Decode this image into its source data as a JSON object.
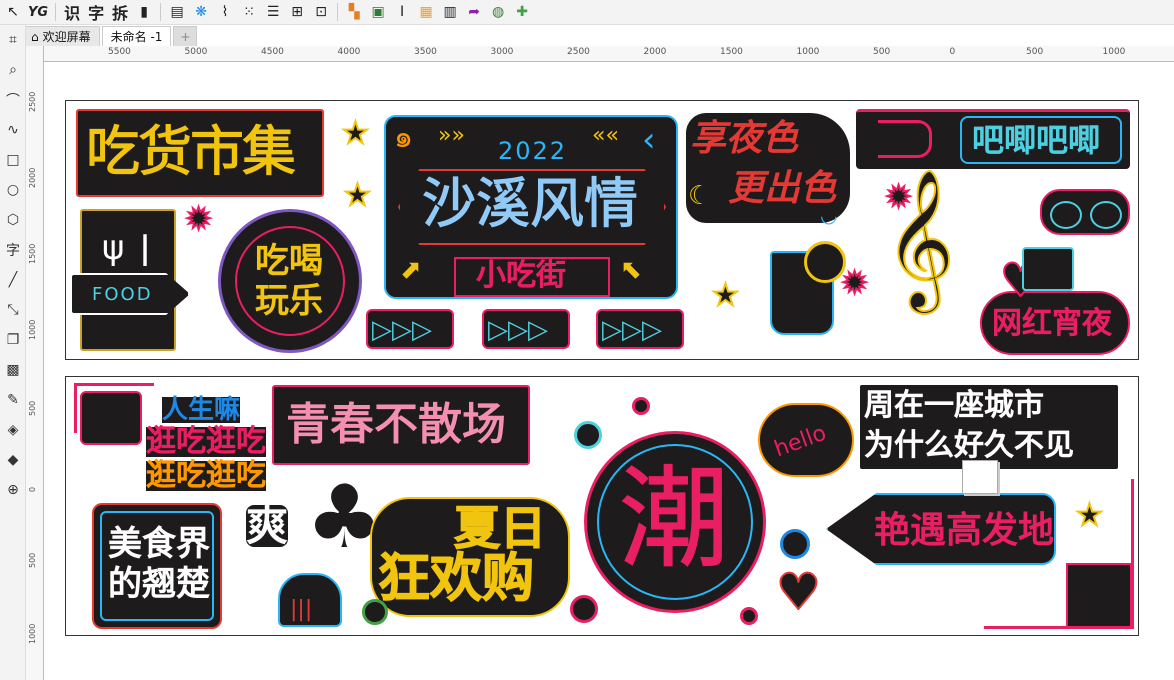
{
  "toolbar": {
    "yg": "YG",
    "shi": "识",
    "zi": "字",
    "chai": "拆"
  },
  "tabs": {
    "welcome": "欢迎屏幕",
    "doc": "未命名 -1",
    "add": "+"
  },
  "ruler": {
    "h": [
      "5500",
      "5000",
      "4500",
      "4000",
      "3500",
      "3000",
      "2500",
      "2000",
      "1500",
      "1000",
      "500",
      "0",
      "500",
      "1000"
    ],
    "v": [
      "2500",
      "2000",
      "1500",
      "1000",
      "500",
      "0",
      "500",
      "1000"
    ]
  },
  "signs": {
    "chihuo": "吃货市集",
    "year": "2022",
    "shaxi": "沙溪风情",
    "xiaochi": "小吃街",
    "xiangyese1": "享夜色",
    "xiangyese2": "更出色",
    "bala": "吧唧吧唧",
    "food": "FOOD",
    "chihe1": "吃喝",
    "chihe2": "玩乐",
    "wanghong": "网红宵夜",
    "rensheng": "人生嘛",
    "guang1": "逛吃逛吃",
    "guang2": "逛吃逛吃",
    "qingchun": "青春不散场",
    "hello": "hello",
    "city1": "周在一座城市",
    "city2": "为什么好久不见",
    "meishi1": "美食界",
    "meishi2": "的翘楚",
    "shuang": "爽",
    "summer1": "夏日",
    "summer2": "狂欢购",
    "chao": "潮",
    "yanyu": "艳遇高发地"
  }
}
